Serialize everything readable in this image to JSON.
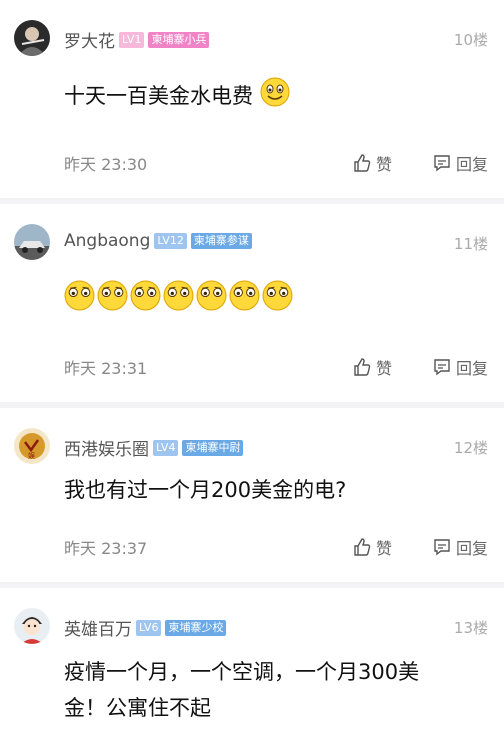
{
  "comments": [
    {
      "username": "罗大花",
      "level": "LV1",
      "rank": "柬埔寨小兵",
      "floor": "10楼",
      "content": "十天一百美金水电费",
      "emojis": [
        "smile-emoji"
      ],
      "time": "昨天 23:30",
      "like_label": "赞",
      "reply_label": "回复",
      "badge_color": "#f184c6"
    },
    {
      "username": "Angbaong",
      "level": "LV12",
      "rank": "柬埔寨参谋",
      "floor": "11楼",
      "content": "",
      "emojis": [
        "wide-eyed-emoji",
        "wide-eyed-emoji",
        "wide-eyed-emoji",
        "wide-eyed-emoji",
        "wide-eyed-emoji",
        "wide-eyed-emoji",
        "wide-eyed-emoji"
      ],
      "time": "昨天 23:31",
      "like_label": "赞",
      "reply_label": "回复",
      "badge_color": "#6aa8e6"
    },
    {
      "username": "西港娱乐圈",
      "level": "LV4",
      "rank": "柬埔寨中尉",
      "floor": "12楼",
      "content": "我也有过一个月200美金的电?",
      "emojis": [],
      "time": "昨天 23:37",
      "like_label": "赞",
      "reply_label": "回复",
      "badge_color": "#6aa8e6"
    },
    {
      "username": "英雄百万",
      "level": "LV6",
      "rank": "柬埔寨少校",
      "floor": "13楼",
      "content_line1": "疫情一个月，一个空调，一个月300美",
      "content_line2": "金！公寓住不起",
      "badge_color": "#6aa8e6"
    }
  ]
}
